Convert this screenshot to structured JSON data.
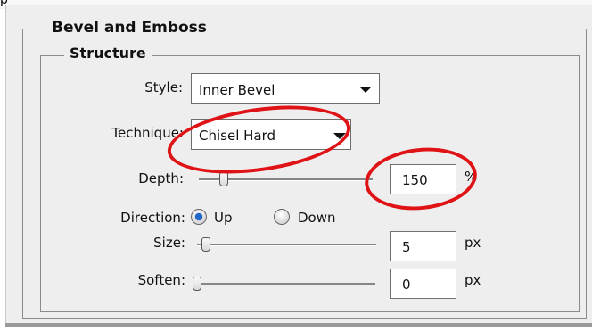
{
  "panel": {
    "top_fragment": "p",
    "section_title": "Bevel and Emboss",
    "subsection_title": "Structure"
  },
  "fields": {
    "style": {
      "label": "Style:",
      "value": "Inner Bevel"
    },
    "technique": {
      "label": "Technique:",
      "value": "Chisel Hard"
    },
    "depth": {
      "label": "Depth:",
      "value": "150",
      "unit": "%",
      "slider_fraction": 0.15
    },
    "direction": {
      "label": "Direction:",
      "options": [
        {
          "label": "Up",
          "selected": true
        },
        {
          "label": "Down",
          "selected": false
        }
      ]
    },
    "size": {
      "label": "Size:",
      "value": "5",
      "unit": "px",
      "slider_fraction": 0.02
    },
    "soften": {
      "label": "Soften:",
      "value": "0",
      "unit": "px",
      "slider_fraction": 0.0
    }
  },
  "annotations": {
    "color": "#df1215",
    "targets": [
      "technique-dropdown",
      "depth-input"
    ]
  },
  "colors": {
    "panel_background": "#eeeeee",
    "annotation_red": "#df1215",
    "radio_selected": "#1d67c8"
  }
}
